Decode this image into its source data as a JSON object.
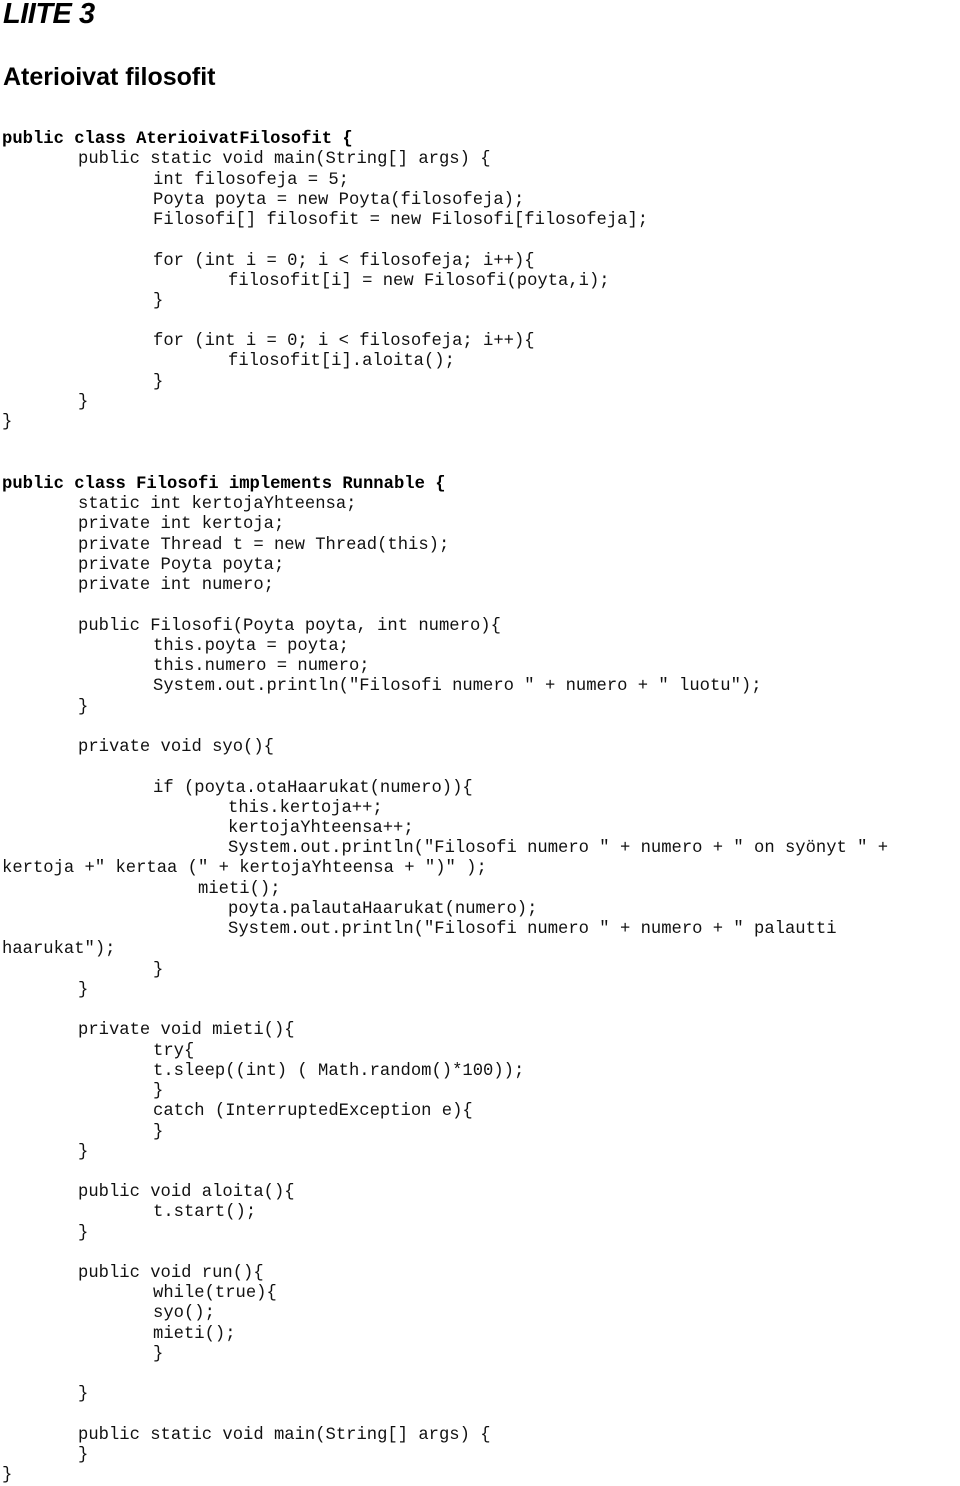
{
  "document": {
    "appendix_label": "LIITE 3",
    "title": "Aterioivat filosofit",
    "code_lines": [
      "public class AterioivatFilosofit {",
      "public static void main(String[] args) {",
      "int filosofeja = 5;",
      "Poyta poyta = new Poyta(filosofeja);",
      "Filosofi[] filosofit = new Filosofi[filosofeja];",
      "for (int i = 0; i < filosofeja; i++){",
      "filosofit[i] = new Filosofi(poyta,i);",
      "}",
      "for (int i = 0; i < filosofeja; i++){",
      "filosofit[i].aloita();",
      "}",
      "}",
      "}",
      "public class Filosofi implements Runnable {",
      "static int kertojaYhteensa;",
      "private int kertoja;",
      "private Thread t = new Thread(this);",
      "private Poyta poyta;",
      "private int numero;",
      "public Filosofi(Poyta poyta, int numero){",
      "this.poyta = poyta;",
      "this.numero = numero;",
      "System.out.println(\"Filosofi numero \" + numero + \" luotu\");",
      "}",
      "private void syo(){",
      "if (poyta.otaHaarukat(numero)){",
      "this.kertoja++;",
      "kertojaYhteensa++;",
      "System.out.println(\"Filosofi numero \" + numero + \" on syönyt \" +",
      "kertoja +\" kertaa (\" + kertojaYhteensa + \")\" );",
      "mieti();",
      "poyta.palautaHaarukat(numero);",
      "System.out.println(\"Filosofi numero \" + numero + \" palautti",
      "haarukat\");",
      "}",
      "}",
      "private void mieti(){",
      "try{",
      "t.sleep((int) ( Math.random()*100));",
      "}",
      "catch (InterruptedException e){",
      "}",
      "}",
      "public void aloita(){",
      "t.start();",
      "}",
      "public void run(){",
      "while(true){",
      "syo();",
      "mieti();",
      "}",
      "}",
      "public static void main(String[] args) {",
      "}",
      "}"
    ]
  }
}
